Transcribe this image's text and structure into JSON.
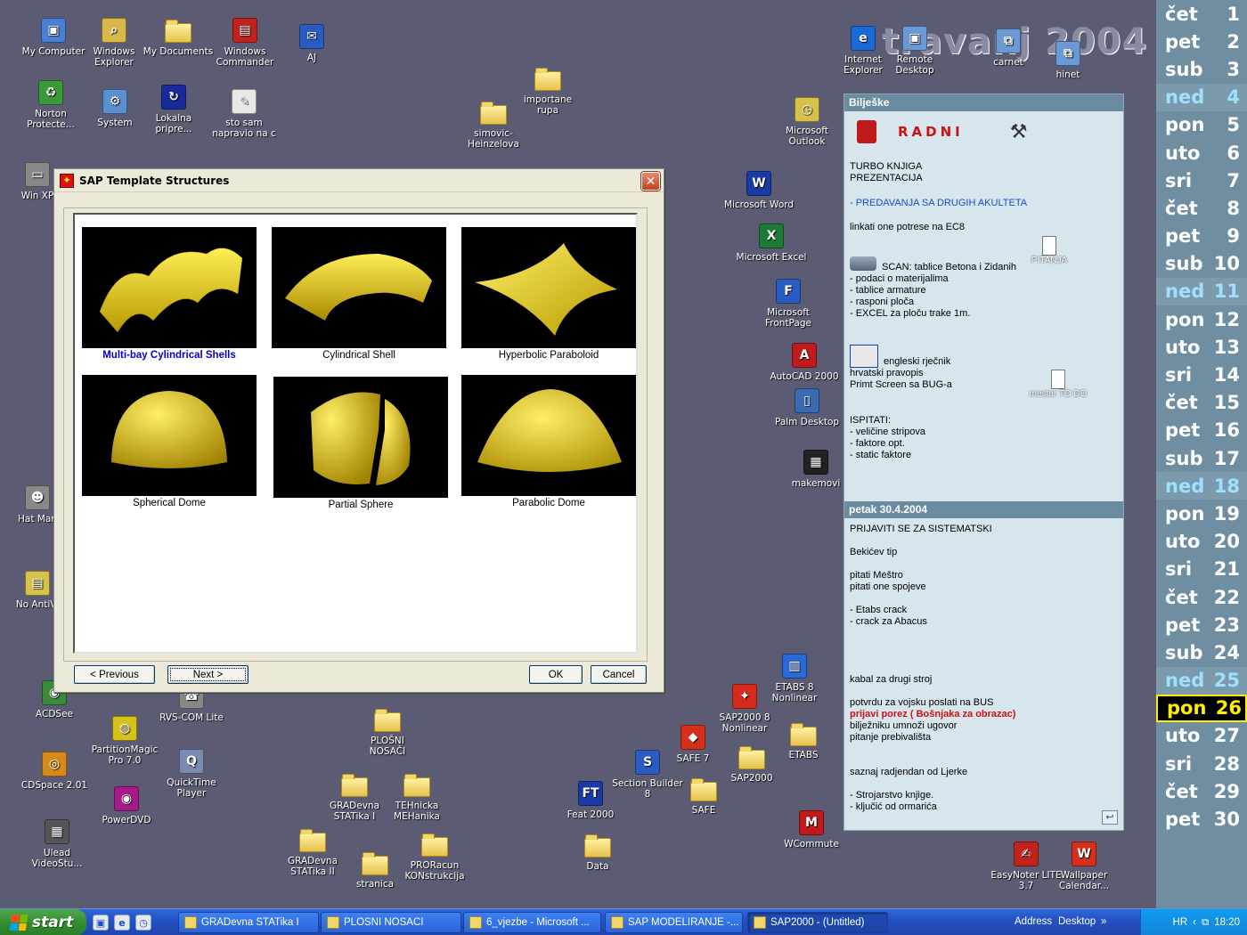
{
  "watermark": "travanj 2004",
  "desktop_icons": [
    {
      "label": "My Computer",
      "kind": "app",
      "color": "#4a7fd6",
      "glyph": "▣"
    },
    {
      "label": "Windows Explorer",
      "kind": "app",
      "color": "#d9b84a",
      "glyph": "⌕"
    },
    {
      "label": "My Documents",
      "kind": "folder"
    },
    {
      "label": "Windows Commander",
      "kind": "app",
      "color": "#c0221c",
      "glyph": "▤"
    },
    {
      "label": "AJ",
      "kind": "app",
      "color": "#2a5bc0",
      "glyph": "✉"
    },
    {
      "label": "Norton Protecte...",
      "kind": "app",
      "color": "#3a9a3a",
      "glyph": "♻"
    },
    {
      "label": "System",
      "kind": "app",
      "color": "#5a8fd0",
      "glyph": "⚙"
    },
    {
      "label": "Lokalna pripre...",
      "kind": "app",
      "color": "#1a2a9a",
      "glyph": "↻"
    },
    {
      "label": "sto sam napravio na c",
      "kind": "app",
      "color": "#e8e8e8",
      "glyph": "✎"
    },
    {
      "label": "simovic-Heinzelova",
      "kind": "folder"
    },
    {
      "label": "importane rupa",
      "kind": "folder"
    },
    {
      "label": "Win XP",
      "kind": "app",
      "color": "#888",
      "glyph": "▭"
    },
    {
      "label": "Internet Explorer",
      "kind": "app",
      "color": "#1a6ad6",
      "glyph": "e"
    },
    {
      "label": "Remote Desktop",
      "kind": "app",
      "color": "#6a9ad6",
      "glyph": "▣"
    },
    {
      "label": "carnet",
      "kind": "app",
      "color": "#6a9ad6",
      "glyph": "⧉"
    },
    {
      "label": "hinet",
      "kind": "app",
      "color": "#6a9ad6",
      "glyph": "⧉"
    },
    {
      "label": "Microsoft Outlook",
      "kind": "app",
      "color": "#d6c24a",
      "glyph": "◷"
    },
    {
      "label": "Microsoft Word",
      "kind": "app",
      "color": "#1a3aa6",
      "glyph": "W"
    },
    {
      "label": "Microsoft Excel",
      "kind": "app",
      "color": "#1e7b36",
      "glyph": "X"
    },
    {
      "label": "Microsoft FrontPage",
      "kind": "app",
      "color": "#2a5bc0",
      "glyph": "F"
    },
    {
      "label": "AutoCAD 2000",
      "kind": "app",
      "color": "#c01a1a",
      "glyph": "A"
    },
    {
      "label": "Palm Desktop",
      "kind": "app",
      "color": "#3a6ab0",
      "glyph": "▯"
    },
    {
      "label": "makemovi",
      "kind": "app",
      "color": "#222",
      "glyph": "▦"
    },
    {
      "label": "Hat Man",
      "kind": "app",
      "color": "#888",
      "glyph": "☻"
    },
    {
      "label": "No AntiVi",
      "kind": "app",
      "color": "#d6c24a",
      "glyph": "▤"
    },
    {
      "label": "ACDSee",
      "kind": "app",
      "color": "#3a8a3a",
      "glyph": "◉"
    },
    {
      "label": "RVS-COM Lite",
      "kind": "app",
      "color": "#888",
      "glyph": "☎"
    },
    {
      "label": "PartitionMagic Pro 7.0",
      "kind": "app",
      "color": "#d6c21a",
      "glyph": "◍"
    },
    {
      "label": "QuickTime Player",
      "kind": "app",
      "color": "#7a8ab0",
      "glyph": "Q"
    },
    {
      "label": "CDSpace 2.01",
      "kind": "app",
      "color": "#d68a1a",
      "glyph": "◎"
    },
    {
      "label": "PowerDVD",
      "kind": "app",
      "color": "#a61a8a",
      "glyph": "◉"
    },
    {
      "label": "Ulead VideoStu...",
      "kind": "app",
      "color": "#555",
      "glyph": "▦"
    },
    {
      "label": "PLOŠNI NOSAČI",
      "kind": "folder"
    },
    {
      "label": "GRADevna STATika I",
      "kind": "folder"
    },
    {
      "label": "TEHnicka MEHanika",
      "kind": "folder"
    },
    {
      "label": "GRADevna STATika II",
      "kind": "folder"
    },
    {
      "label": "stranica",
      "kind": "folder"
    },
    {
      "label": "PRORacun KONstrukcija",
      "kind": "folder"
    },
    {
      "label": "Data",
      "kind": "folder"
    },
    {
      "label": "Feat 2000",
      "kind": "app",
      "color": "#1a3aa6",
      "glyph": "FT"
    },
    {
      "label": "Section Builder 8",
      "kind": "app",
      "color": "#2a5bc0",
      "glyph": "S"
    },
    {
      "label": "SAFE 7",
      "kind": "app",
      "color": "#d6301a",
      "glyph": "◆"
    },
    {
      "label": "SAFE",
      "kind": "folder"
    },
    {
      "label": "SAP2000 8 Nonlinear",
      "kind": "app",
      "color": "#d62a1a",
      "glyph": "✦"
    },
    {
      "label": "SAP2000",
      "kind": "folder"
    },
    {
      "label": "ETABS 8 Nonlinear",
      "kind": "app",
      "color": "#2a6ad6",
      "glyph": "▥"
    },
    {
      "label": "ETABS",
      "kind": "folder"
    },
    {
      "label": "WCommute",
      "kind": "app",
      "color": "#c01a1a",
      "glyph": "M"
    },
    {
      "label": "EasyNoter LITE 3.7",
      "kind": "app",
      "color": "#c0221c",
      "glyph": "✍"
    },
    {
      "label": "Wallpaper Calendar...",
      "kind": "app",
      "color": "#d6301a",
      "glyph": "W"
    }
  ],
  "calendar": [
    {
      "day": "čet",
      "num": "1"
    },
    {
      "day": "pet",
      "num": "2"
    },
    {
      "day": "sub",
      "num": "3"
    },
    {
      "day": "ned",
      "num": "4",
      "sunday": true
    },
    {
      "day": "pon",
      "num": "5"
    },
    {
      "day": "uto",
      "num": "6"
    },
    {
      "day": "sri",
      "num": "7"
    },
    {
      "day": "čet",
      "num": "8"
    },
    {
      "day": "pet",
      "num": "9"
    },
    {
      "day": "sub",
      "num": "10"
    },
    {
      "day": "ned",
      "num": "11",
      "sunday": true
    },
    {
      "day": "pon",
      "num": "12"
    },
    {
      "day": "uto",
      "num": "13"
    },
    {
      "day": "sri",
      "num": "14"
    },
    {
      "day": "čet",
      "num": "15"
    },
    {
      "day": "pet",
      "num": "16"
    },
    {
      "day": "sub",
      "num": "17"
    },
    {
      "day": "ned",
      "num": "18",
      "sunday": true
    },
    {
      "day": "pon",
      "num": "19"
    },
    {
      "day": "uto",
      "num": "20"
    },
    {
      "day": "sri",
      "num": "21"
    },
    {
      "day": "čet",
      "num": "22"
    },
    {
      "day": "pet",
      "num": "23"
    },
    {
      "day": "sub",
      "num": "24"
    },
    {
      "day": "ned",
      "num": "25",
      "sunday": true
    },
    {
      "day": "pon",
      "num": "26",
      "today": true
    },
    {
      "day": "uto",
      "num": "27"
    },
    {
      "day": "sri",
      "num": "28"
    },
    {
      "day": "čet",
      "num": "29"
    },
    {
      "day": "pet",
      "num": "30"
    }
  ],
  "notes": {
    "header": "Bilješke",
    "radni": "RADNI",
    "section1": [
      "TURBO KNJIGA",
      "PREZENTACIJA"
    ],
    "link": "- PREDAVANJA SA DRUGIH AKULTETA",
    "line_ec8": "linkati one potrese na EC8",
    "pitanja": "PITANJA",
    "scan": "SCAN: tablice Betona i Zidanih",
    "scan_items": [
      "- podaci o materijalima",
      "- tablice armature",
      "- rasponi ploča",
      "- EXCEL za ploču trake 1m."
    ],
    "dict": "engleski rječnik",
    "dict_items": [
      "hrvatski pravopis",
      "Primt Screen sa BUG-a"
    ],
    "mestar": "mestar TO DO",
    "ispitati": "ISPITATI:",
    "ispitati_items": [
      "- veličine stripova",
      "- faktore opt.",
      "- static faktore"
    ],
    "date_header": "petak 30.4.2004",
    "items": [
      {
        "text": "PRIJAVITI SE ZA SISTEMATSKI"
      },
      {
        "text": ""
      },
      {
        "text": "Bekićev tip"
      },
      {
        "text": ""
      },
      {
        "text": "pitati Meštro"
      },
      {
        "text": "pitati one spojeve"
      },
      {
        "text": ""
      },
      {
        "text": "- Etabs crack"
      },
      {
        "text": "- crack za Abacus"
      },
      {
        "text": ""
      },
      {
        "text": ""
      },
      {
        "text": ""
      },
      {
        "text": ""
      },
      {
        "text": "kabal za drugi stroj"
      },
      {
        "text": ""
      },
      {
        "text": "potvrdu za vojsku poslati na BUS"
      },
      {
        "text": "prijavi porez ( Bošnjaka za obrazac)",
        "red": true
      },
      {
        "text": "bilježniku umnoži ugovor"
      },
      {
        "text": "pitanje prebivališta"
      },
      {
        "text": ""
      },
      {
        "text": ""
      },
      {
        "text": "saznaj radjendan od Ljerke"
      },
      {
        "text": ""
      },
      {
        "text": "- Strojarstvo knjige."
      },
      {
        "text": "- ključić od ormarića"
      }
    ]
  },
  "dialog": {
    "title": "SAP Template Structures",
    "close": "✕",
    "templates": [
      {
        "caption": "Multi-bay Cylindrical Shells",
        "shape": "multibay",
        "selected": true
      },
      {
        "caption": "Cylindrical Shell",
        "shape": "cylinder"
      },
      {
        "caption": "Hyperbolic Paraboloid",
        "shape": "hypar"
      },
      {
        "caption": "Spherical Dome",
        "shape": "sphere"
      },
      {
        "caption": "Partial Sphere",
        "shape": "partial"
      },
      {
        "caption": "Parabolic Dome",
        "shape": "parabolic"
      }
    ],
    "buttons": {
      "previous": "< Previous",
      "next": "Next >",
      "ok": "OK",
      "cancel": "Cancel"
    }
  },
  "taskbar": {
    "start": "start",
    "tasks": [
      "GRADevna STATika I",
      "PLOSNI NOSACI",
      "6_vjezbe - Microsoft ...",
      "SAP MODELIRANJE -...",
      "SAP2000 - (Untitled)"
    ],
    "address": "Address",
    "desktop": "Desktop",
    "lang": "HR",
    "clock": "18:20"
  }
}
